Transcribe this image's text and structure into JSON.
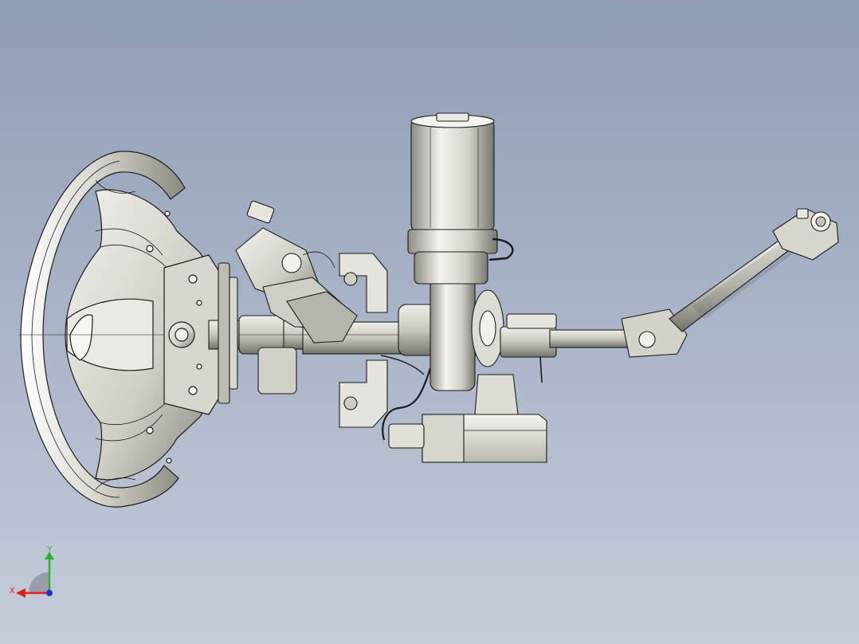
{
  "viewport": {
    "background_top": "#8f9db5",
    "background_bottom": "#c6ccd9",
    "model": "steering-column-assembly"
  },
  "triad": {
    "x_label": "X",
    "y_label": "Y",
    "x_color": "#e0201a",
    "y_color": "#22b822",
    "z_color": "#2030d0"
  },
  "colors": {
    "metal_light": "#f0efe9",
    "metal_mid": "#c9c8c0",
    "metal_dark": "#7c7b74",
    "edge": "#1c1c1c"
  }
}
